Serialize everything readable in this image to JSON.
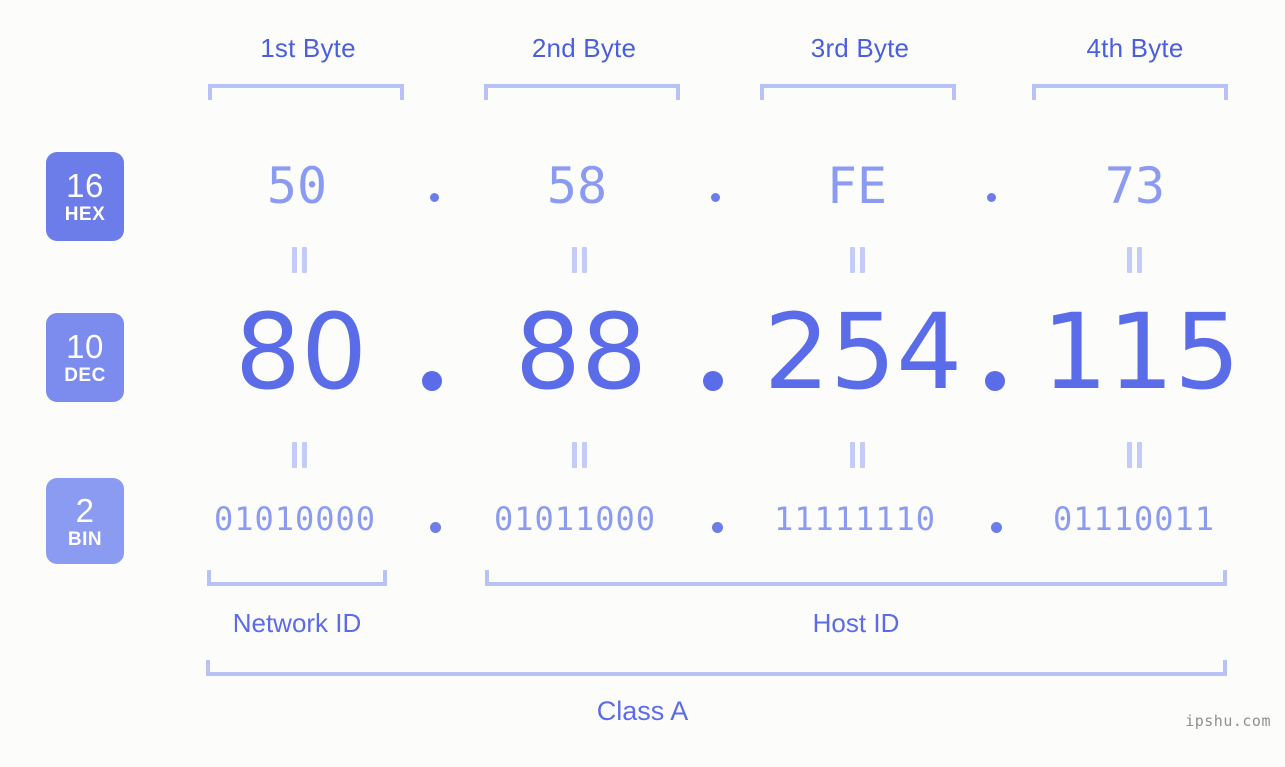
{
  "ip": {
    "address_decimal": "80.88.254.115",
    "class_label": "Class A"
  },
  "headers": {
    "byte1": "1st Byte",
    "byte2": "2nd Byte",
    "byte3": "3rd Byte",
    "byte4": "4th Byte"
  },
  "bases": {
    "hex": {
      "radix": "16",
      "name": "HEX"
    },
    "dec": {
      "radix": "10",
      "name": "DEC"
    },
    "bin": {
      "radix": "2",
      "name": "BIN"
    }
  },
  "rows": {
    "hex": {
      "b1": "50",
      "b2": "58",
      "b3": "FE",
      "b4": "73"
    },
    "dec": {
      "b1": "80",
      "b2": "88",
      "b3": "254",
      "b4": "115"
    },
    "bin": {
      "b1": "01010000",
      "b2": "01011000",
      "b3": "11111110",
      "b4": "01110011"
    }
  },
  "separator": ".",
  "equals": "=",
  "segments": {
    "network_id": "Network ID",
    "host_id": "Host ID"
  },
  "watermark": "ipshu.com",
  "colors": {
    "background": "#fcfdfa",
    "accent_strong": "#4a5fe0",
    "accent": "#5b6ce8",
    "accent_mid": "#6c7ce8",
    "accent_light": "#8b9bf2",
    "bracket": "#b9c2f7",
    "badge_hex": "#6c7ce8",
    "badge_dec": "#7b8bee",
    "badge_bin": "#8b9bf2",
    "watermark": "#8f8f8f"
  }
}
